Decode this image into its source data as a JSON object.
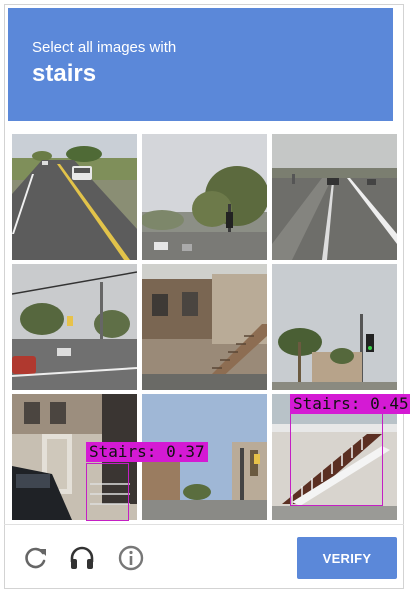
{
  "challenge": {
    "instruction": "Select all images with",
    "keyword": "stairs"
  },
  "tiles": [
    {
      "name": "tile-1-road-with-truck"
    },
    {
      "name": "tile-2-trees-traffic-light"
    },
    {
      "name": "tile-3-highway-cars"
    },
    {
      "name": "tile-4-street-intersection"
    },
    {
      "name": "tile-5-house-with-stairs"
    },
    {
      "name": "tile-6-palm-tree-traffic-light"
    },
    {
      "name": "tile-7-building-door-car"
    },
    {
      "name": "tile-8-town-street"
    },
    {
      "name": "tile-9-porch-stairs"
    }
  ],
  "detections": [
    {
      "label": "Stairs: 0.37"
    },
    {
      "label": "Stairs: 0.45"
    }
  ],
  "footer": {
    "reload_icon": "reload-icon",
    "audio_icon": "headphones-icon",
    "info_icon": "info-icon",
    "verify_label": "VERIFY"
  },
  "colors": {
    "accent": "#5b88d9",
    "detection": "#d41ad4"
  }
}
